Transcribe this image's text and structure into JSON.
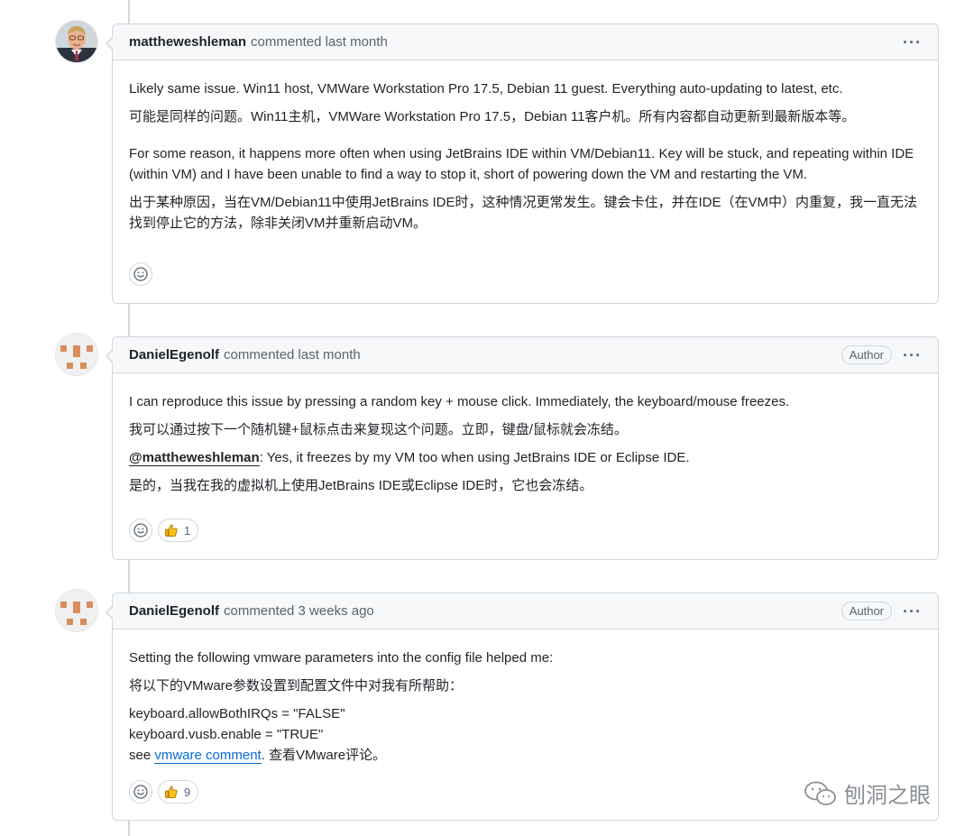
{
  "comments": [
    {
      "author": "mattheweshleman",
      "meta": "commented last month",
      "badge": "",
      "menu": "···",
      "lines": {
        "l1": "Likely same issue. Win11 host, VMWare Workstation Pro 17.5, Debian 11 guest. Everything auto-updating to latest, etc.",
        "l2": "可能是同样的问题。Win11主机，VMWare Workstation Pro 17.5，Debian 11客户机。所有内容都自动更新到最新版本等。",
        "l3": "For some reason, it happens more often when using JetBrains IDE within VM/Debian11. Key will be stuck, and repeating within IDE (within VM) and I have been unable to find a way to stop it, short of powering down the VM and restarting the VM.",
        "l4": "出于某种原因，当在VM/Debian11中使用JetBrains IDE时，这种情况更常发生。键会卡住，并在IDE（在VM中）内重复，我一直无法找到停止它的方法，除非关闭VM并重新启动VM。"
      }
    },
    {
      "author": "DanielEgenolf",
      "meta": "commented last month",
      "badge": "Author",
      "menu": "···",
      "lines": {
        "l1": "I can reproduce this issue by pressing a random key + mouse click. Immediately, the keyboard/mouse freezes.",
        "l2": "我可以通过按下一个随机键+鼠标点击来复现这个问题。立即，键盘/鼠标就会冻结。",
        "mention": "@mattheweshleman",
        "l3": ": Yes, it freezes by my VM too when using JetBrains IDE or Eclipse IDE.",
        "l4": "是的，当我在我的虚拟机上使用JetBrains IDE或Eclipse IDE时，它也会冻结。"
      },
      "thumbs_count": "1"
    },
    {
      "author": "DanielEgenolf",
      "meta": "commented 3 weeks ago",
      "badge": "Author",
      "menu": "···",
      "lines": {
        "l1": "Setting the following vmware parameters into the config file helped me:",
        "l2": "将以下的VMware参数设置到配置文件中对我有所帮助：",
        "c1": "keyboard.allowBothIRQs = \"FALSE\"",
        "c2": "keyboard.vusb.enable = \"TRUE\"",
        "see": "see ",
        "link": "vmware comment",
        "after": ". 查看VMware评论。"
      },
      "thumbs_count": "9"
    }
  ],
  "watermark": "刨洞之眼",
  "icons": {
    "smiley": "smiley-icon",
    "thumbs_up": "thumbs-up-icon",
    "kebab": "kebab-horizontal-icon",
    "wechat": "wechat-icon"
  },
  "colors": {
    "border": "#d0d7de",
    "header_bg": "#f6f8fa",
    "link": "#0969da",
    "muted": "#59636e"
  }
}
